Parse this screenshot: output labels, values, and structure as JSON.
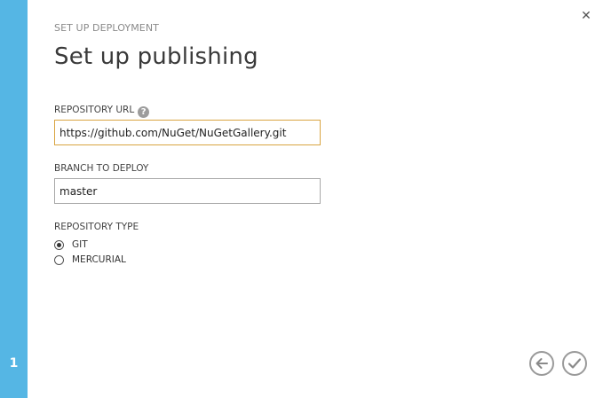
{
  "wizard": {
    "step_number": "1",
    "overline": "SET UP DEPLOYMENT",
    "title": "Set up publishing",
    "close_glyph": "✕"
  },
  "repository_url": {
    "label": "REPOSITORY URL",
    "help_glyph": "?",
    "value": "https://github.com/NuGet/NuGetGallery.git"
  },
  "branch": {
    "label": "BRANCH TO DEPLOY",
    "value": "master"
  },
  "repository_type": {
    "label": "REPOSITORY TYPE",
    "options": [
      {
        "label": "GIT",
        "selected": true
      },
      {
        "label": "MERCURIAL",
        "selected": false
      }
    ]
  },
  "footer": {
    "back_icon": "arrow-left-icon",
    "confirm_icon": "checkmark-icon"
  },
  "colors": {
    "accent": "#55b6e4",
    "focus_border": "#d9a441"
  }
}
